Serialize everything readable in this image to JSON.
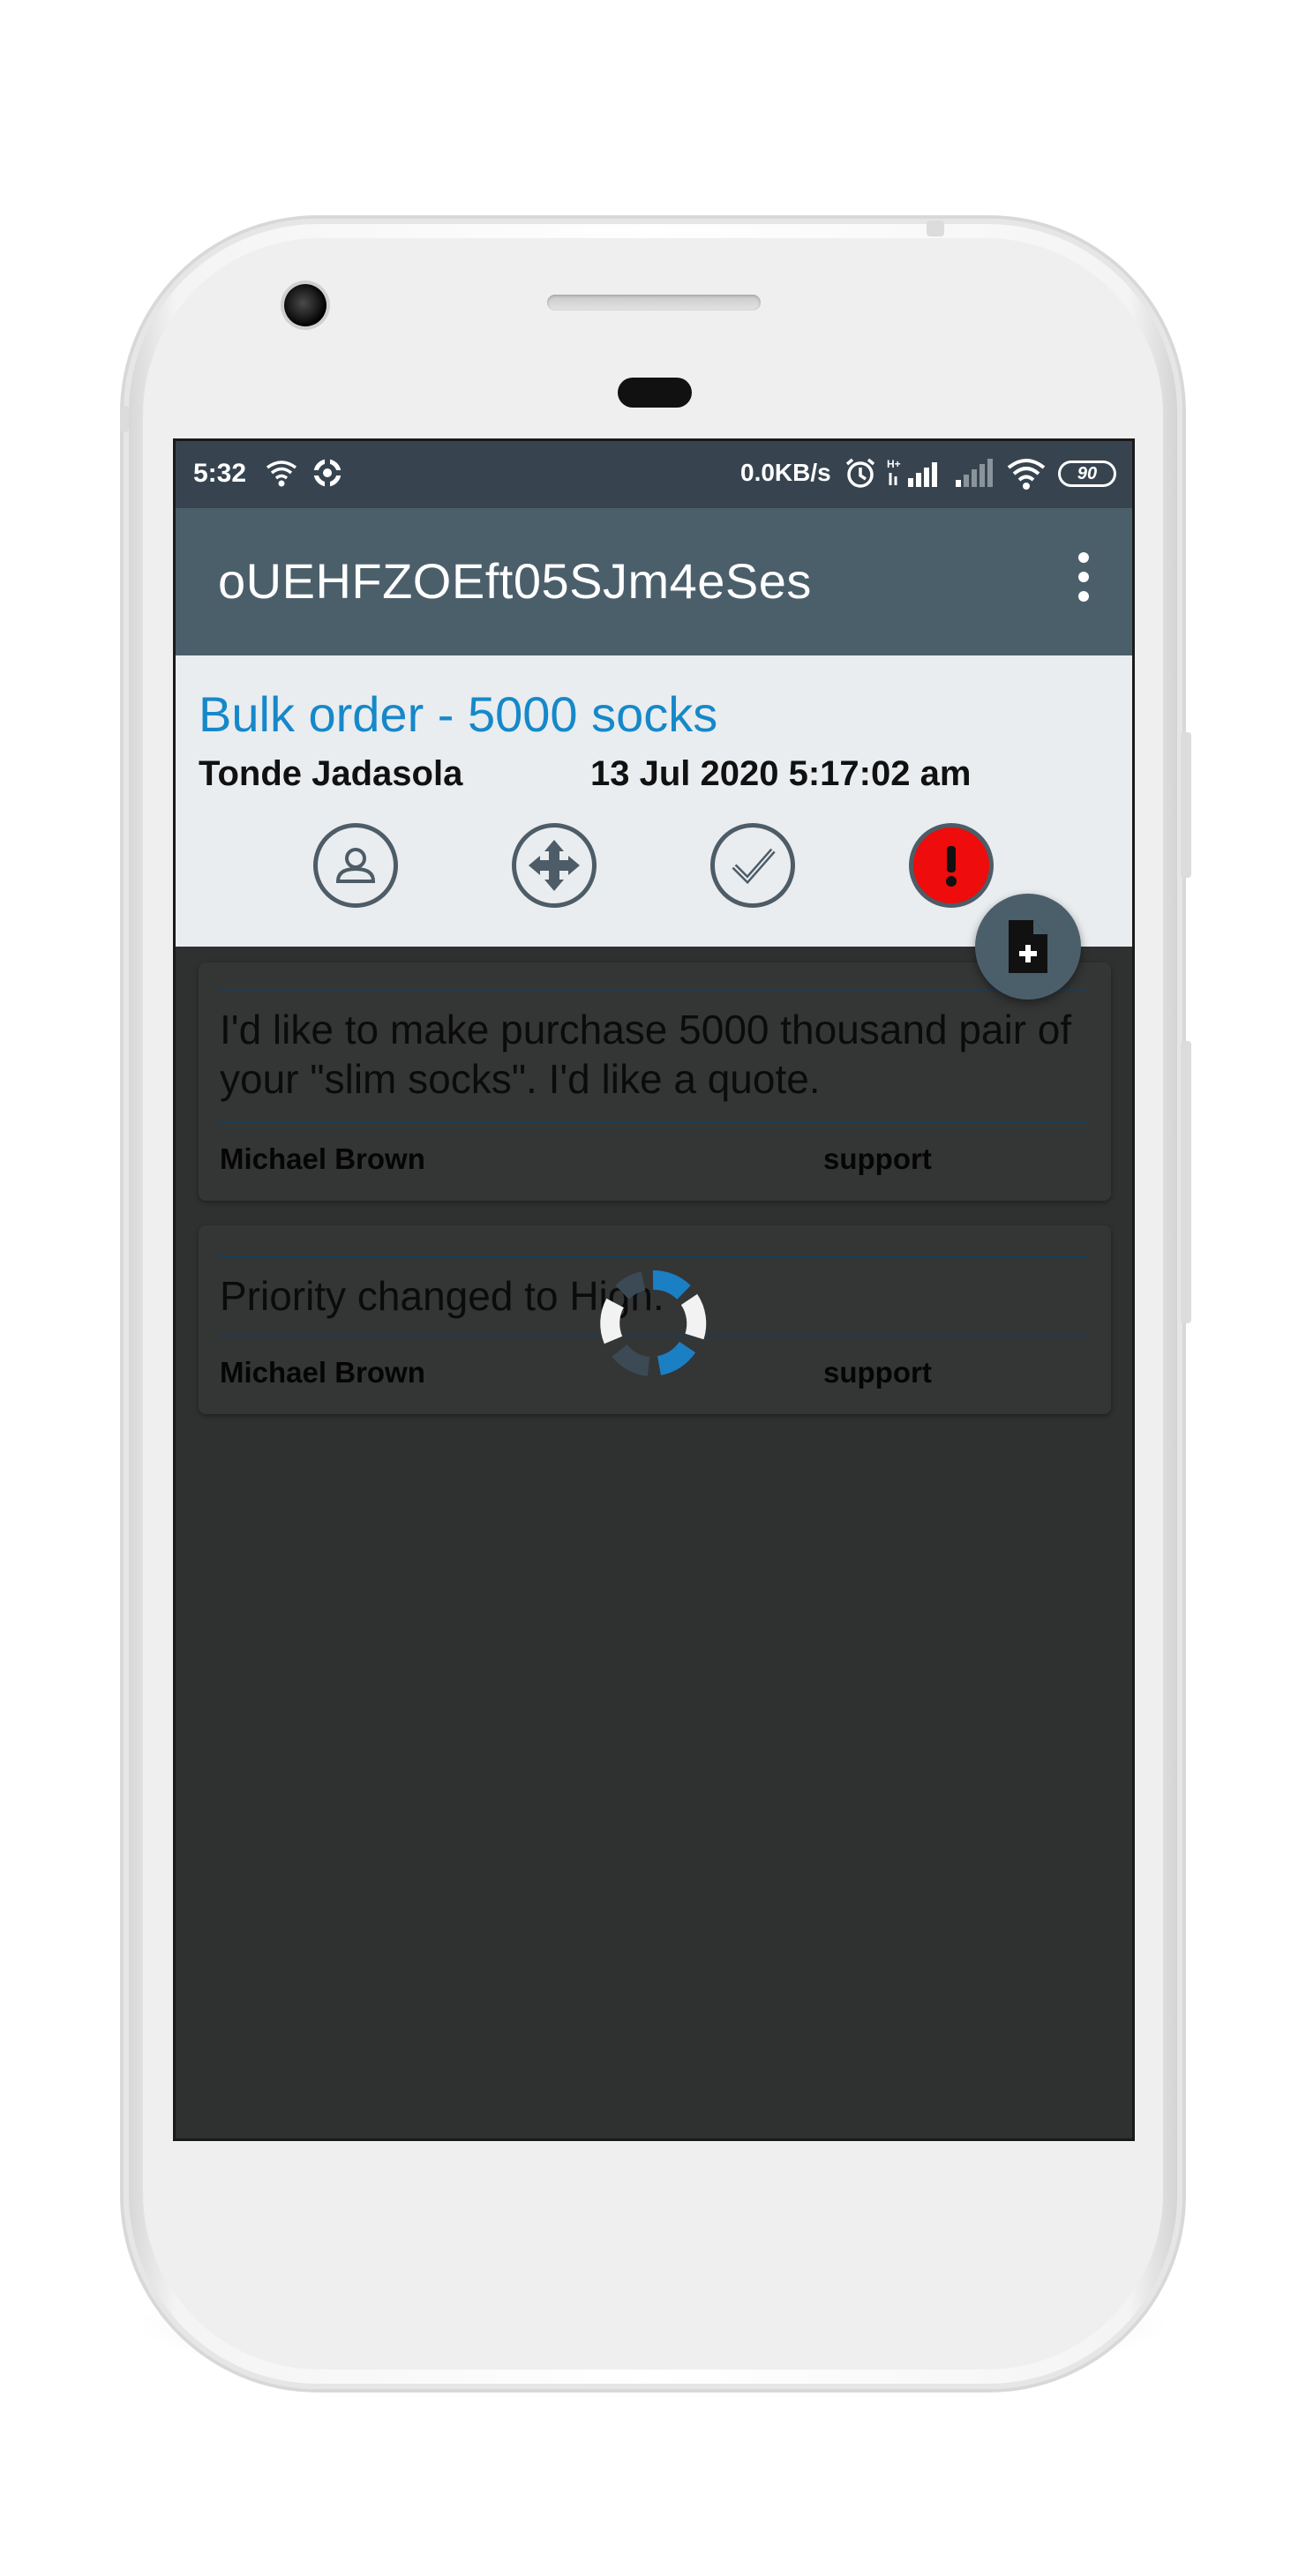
{
  "status_bar": {
    "time": "5:32",
    "network_speed": "0.0KB/s",
    "battery": "90",
    "icons": [
      "wifi-icon",
      "sync-icon",
      "alarm-icon",
      "signal-hplus-icon",
      "signal-icon",
      "wifi-icon"
    ]
  },
  "app_bar": {
    "title": "oUEHFZOEft05SJm4eSes",
    "menu_icon": "overflow-menu-icon"
  },
  "ticket": {
    "subject": "Bulk order - 5000 socks",
    "customer": "Tonde Jadasola",
    "created": "13 Jul 2020 5:17:02 am",
    "actions": [
      {
        "name": "assign-user",
        "icon": "person-icon"
      },
      {
        "name": "move",
        "icon": "move-arrows-icon"
      },
      {
        "name": "resolve",
        "icon": "checkmark-icon"
      },
      {
        "name": "priority",
        "icon": "exclamation-icon",
        "color": "#ee0c0c"
      }
    ]
  },
  "fab": {
    "icon": "add-note-icon"
  },
  "messages": [
    {
      "text": "I'd like to make purchase 5000 thousand pair of your \"slim socks\". I'd like a quote.",
      "author": "Michael Brown",
      "role": "support"
    },
    {
      "text": "Priority changed to High.",
      "author": "Michael Brown",
      "role": "support"
    }
  ],
  "colors": {
    "accent": "#1688c9",
    "app_bar": "#4b5f6b",
    "status_bar": "#374450",
    "priority_high": "#ee0c0c"
  }
}
